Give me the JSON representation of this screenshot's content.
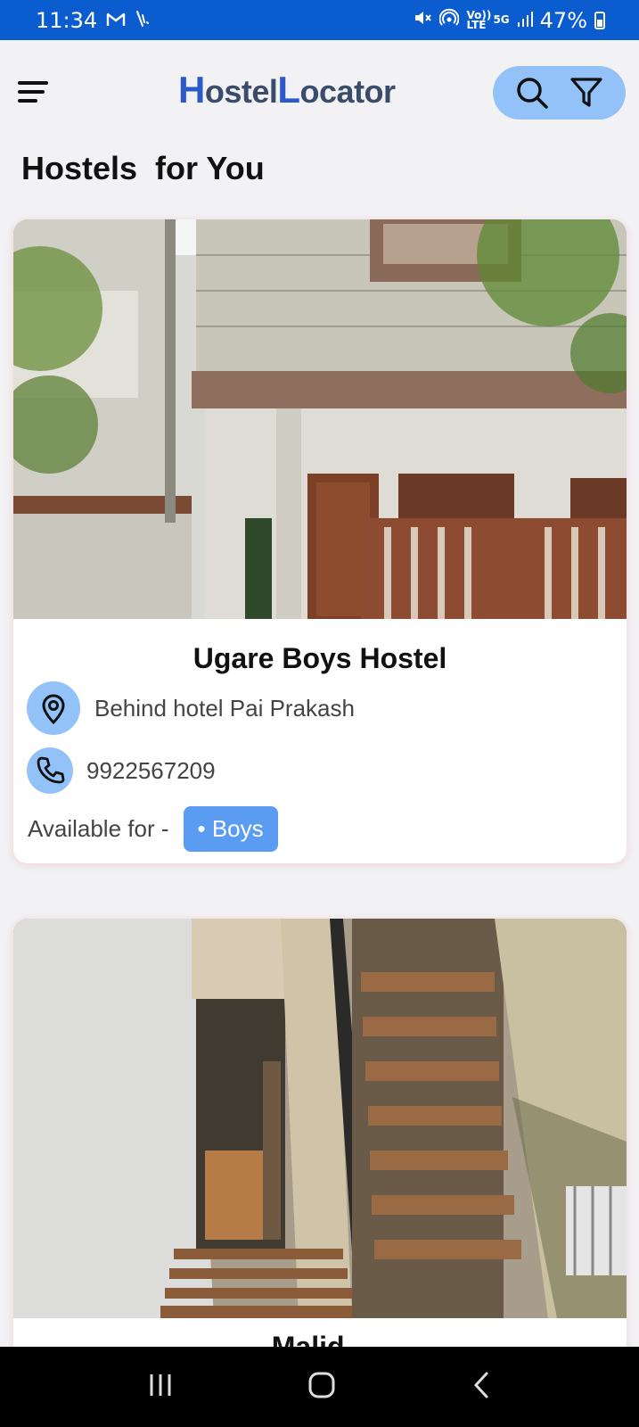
{
  "status_bar": {
    "time": "11:34",
    "volte_label": "Vo)) LTE",
    "net_label": "5G",
    "battery": "47%"
  },
  "app_bar": {
    "logo_h": "H",
    "logo_ostel": "ostel",
    "logo_l": "L",
    "logo_ocator": "ocator"
  },
  "section_title": "Hostels  for You",
  "hostels": [
    {
      "name": "Ugare Boys Hostel",
      "address": "Behind hotel Pai Prakash",
      "phone": "9922567209",
      "available_label": "Available for -",
      "available_for": "• Boys"
    },
    {
      "name": "Malid..."
    }
  ],
  "colors": {
    "status_bar": "#0b5ccf",
    "accent_light": "#93c2f9",
    "chip": "#5b9cf3",
    "logo_cap": "#2b59c7"
  }
}
